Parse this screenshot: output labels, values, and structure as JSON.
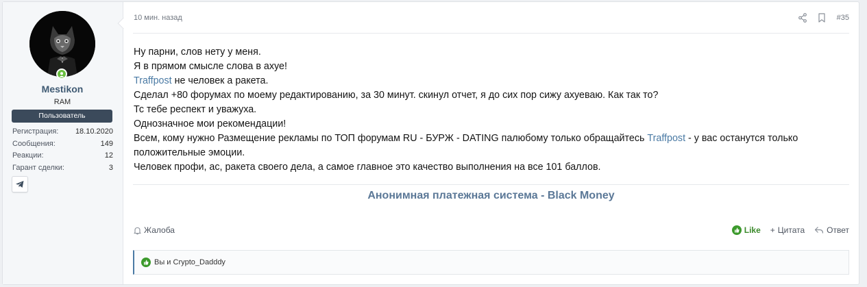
{
  "user": {
    "name": "Mestikon",
    "title": "RAM",
    "banner": "Пользователь",
    "stats": [
      {
        "label": "Регистрация:",
        "value": "18.10.2020"
      },
      {
        "label": "Сообщения:",
        "value": "149"
      },
      {
        "label": "Реакции:",
        "value": "12"
      },
      {
        "label": "Гарант сделки:",
        "value": "3"
      }
    ],
    "contact_icon": "telegram-icon",
    "online_color": "#6abf40"
  },
  "post": {
    "time": "10 мин. назад",
    "number": "#35",
    "header_icons": [
      "share-icon",
      "bookmark-icon"
    ],
    "lines": [
      {
        "pre": "Ну парни, слов нету у меня."
      },
      {
        "pre": "Я в прямом смысле слова в ахуе!"
      },
      {
        "link": "Traffpost",
        "post": " не человек а ракета."
      },
      {
        "pre": "Сделал +80 форумах по моему редактированию, за 30 минут. скинул отчет, я до сих пор сижу ахуеваю. Как так то?"
      },
      {
        "pre": "Тс тебе респект и уважуха."
      },
      {
        "pre": "Однозначное мои рекомендации!"
      },
      {
        "pre": "Всем, кому нужно Размещение рекламы по ТОП форумам RU - БУРЖ - DATING палюбому только обращайтесь ",
        "link": "Traffpost",
        "post": " - у вас останутся только положительные эмоции."
      },
      {
        "pre": "Человек профи, ас, ракета своего дела, а самое главное это качество выполнения на все 101 баллов."
      }
    ],
    "signature": "Анонимная платежная система - Black Money"
  },
  "footer": {
    "report": "Жалоба",
    "like": "Like",
    "quote": "Цитата",
    "reply": "Ответ"
  },
  "reactions": {
    "text": "Вы и Crypto_Dadddy"
  },
  "colors": {
    "accent": "#4a7aa4",
    "like": "#3c8a2c",
    "banner_bg": "#3b4a5b"
  }
}
